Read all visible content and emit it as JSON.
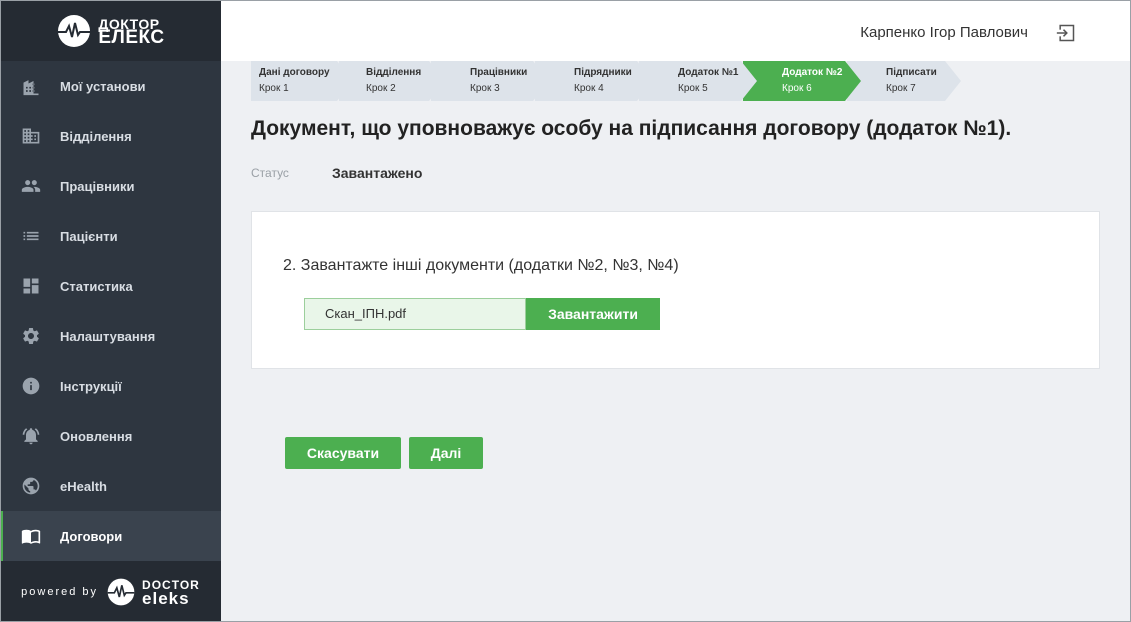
{
  "brand": {
    "line1": "ДОКТОР",
    "line2": "ЕЛЕКС"
  },
  "sidebar": {
    "items": [
      {
        "label": "Мої установи",
        "icon": "building-icon"
      },
      {
        "label": "Відділення",
        "icon": "office-icon"
      },
      {
        "label": "Працівники",
        "icon": "people-icon"
      },
      {
        "label": "Пацієнти",
        "icon": "list-icon"
      },
      {
        "label": "Статистика",
        "icon": "dashboard-icon"
      },
      {
        "label": "Налаштування",
        "icon": "gear-icon"
      },
      {
        "label": "Інструкції",
        "icon": "info-icon"
      },
      {
        "label": "Оновлення",
        "icon": "alarm-bell-icon"
      },
      {
        "label": "eHealth",
        "icon": "globe-icon"
      },
      {
        "label": "Договори",
        "icon": "book-icon",
        "active": true
      }
    ]
  },
  "powered": {
    "prefix": "powered by",
    "line1": "DOCTOR",
    "line2": "eleks"
  },
  "header": {
    "user_name": "Карпенко Ігор Павлович"
  },
  "stepper": {
    "steps": [
      {
        "title": "Дані договору",
        "sub": "Крок 1"
      },
      {
        "title": "Відділення",
        "sub": "Крок 2"
      },
      {
        "title": "Працівники",
        "sub": "Крок 3"
      },
      {
        "title": "Підрядники",
        "sub": "Крок 4"
      },
      {
        "title": "Додаток №1",
        "sub": "Крок 5"
      },
      {
        "title": "Додаток №2",
        "sub": "Крок 6",
        "active": true
      },
      {
        "title": "Підписати",
        "sub": "Крок 7"
      }
    ]
  },
  "page": {
    "title": "Документ, що уповноважує особу на підписання договору (додаток №1).",
    "status_label": "Статус",
    "status_value": "Завантажено"
  },
  "upload": {
    "heading": "2. Завантажте інші документи (додатки №2, №3, №4)",
    "file_name": "Скан_ІПН.pdf",
    "button_label": "Завантажити"
  },
  "actions": {
    "cancel_label": "Скасувати",
    "next_label": "Далі"
  },
  "colors": {
    "accent": "#4caf50",
    "sidebar": "#2e3640",
    "sidebar_dark": "#252b33",
    "step_inactive": "#dde3ea"
  }
}
